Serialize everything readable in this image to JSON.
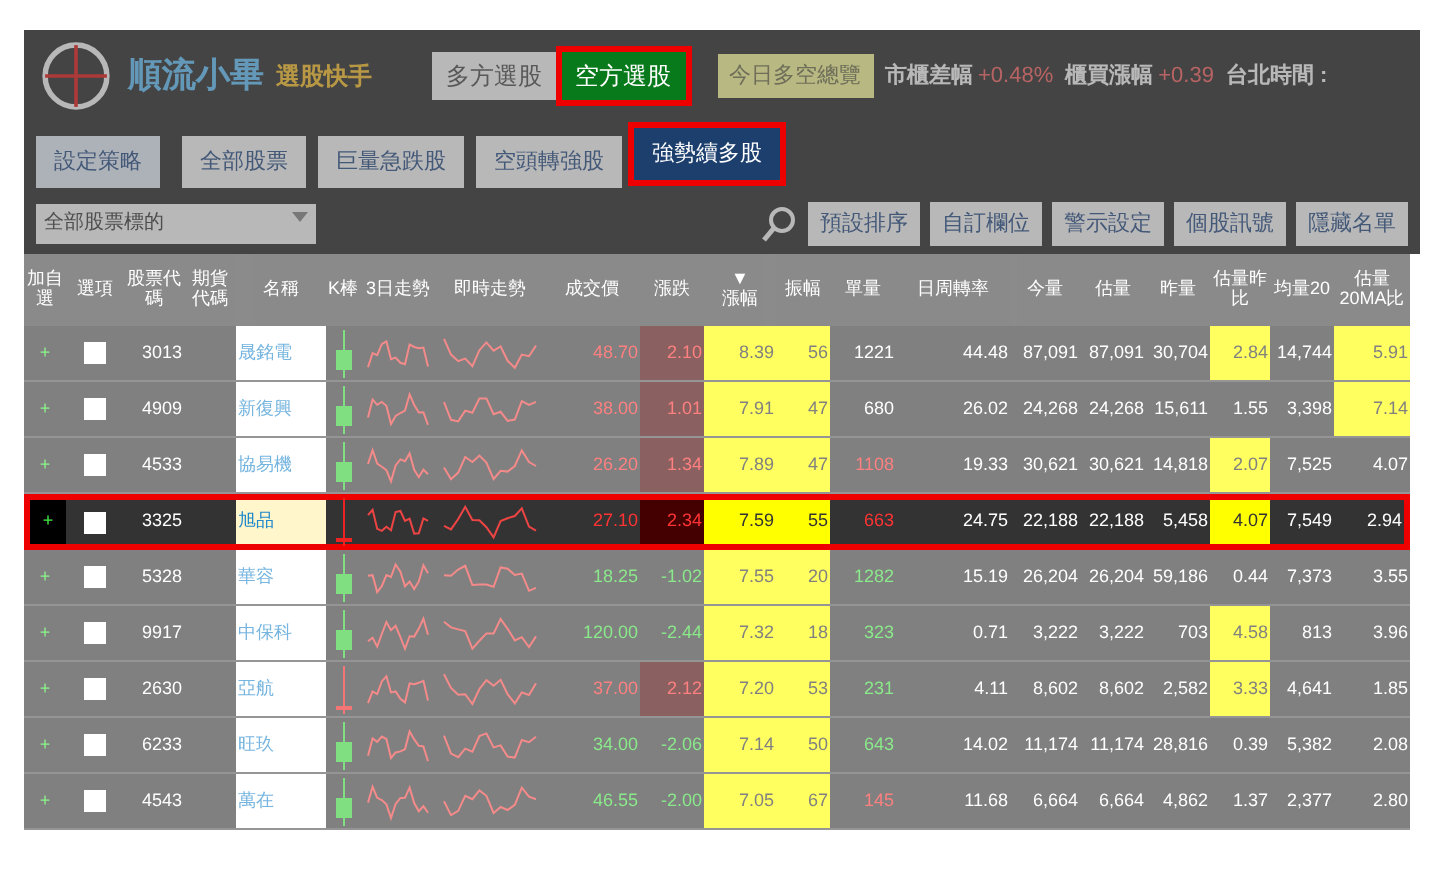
{
  "header": {
    "logo_title": "順流小畢",
    "logo_subtitle": "選股快手",
    "mode_buttons": [
      {
        "label": "多方選股",
        "selected": false
      },
      {
        "label": "空方選股",
        "selected": true
      }
    ],
    "overview_button": "今日多空總覽",
    "indices": [
      {
        "label": "市櫃差幅",
        "value": "+0.48%"
      },
      {
        "label": "櫃買漲幅",
        "value": "+0.39"
      }
    ],
    "clock_label": "台北時間 :"
  },
  "strategy_button": "設定策略",
  "strategy_tabs": [
    {
      "label": "全部股票",
      "selected": false
    },
    {
      "label": "巨量急跌股",
      "selected": false
    },
    {
      "label": "空頭轉強股",
      "selected": false
    },
    {
      "label": "強勢續多股",
      "selected": true
    }
  ],
  "filter_dropdown": "全部股票標的",
  "tool_buttons": [
    "預設排序",
    "自訂欄位",
    "警示設定",
    "個股訊號",
    "隱藏名單"
  ],
  "table": {
    "columns": [
      "加自選",
      "選項",
      "股票代碼",
      "期貨代碼",
      "名稱",
      "K棒",
      "3日走勢",
      "即時走勢",
      "成交價",
      "漲跌",
      "漲幅",
      "振幅",
      "單量",
      "日周轉率",
      "今量",
      "估量",
      "昨量",
      "估量昨比",
      "均量20",
      "估量20MA比"
    ],
    "sorted_column": "▼",
    "rows": [
      {
        "selected": false,
        "add": "+",
        "code": "3013",
        "name": "晟銘電",
        "candle_up": true,
        "price_up": true,
        "price": "48.70",
        "change": "2.10",
        "pct": "8.39",
        "amp": "56",
        "vol": "1221",
        "vol_up": false,
        "vol_down": false,
        "checked": false,
        "turnover": "44.48",
        "today": "87,091",
        "est": "87,091",
        "yest": "30,704",
        "ratio": "2.84",
        "ratio_hl": true,
        "avg20": "14,744",
        "ma": "5.91",
        "ma_hl": true
      },
      {
        "selected": false,
        "add": "+",
        "code": "4909",
        "name": "新復興",
        "candle_up": true,
        "price_up": true,
        "price": "38.00",
        "change": "1.01",
        "pct": "7.91",
        "amp": "47",
        "vol": "680",
        "vol_up": false,
        "vol_down": false,
        "checked": false,
        "turnover": "26.02",
        "today": "24,268",
        "est": "24,268",
        "yest": "15,611",
        "ratio": "1.55",
        "ratio_hl": false,
        "avg20": "3,398",
        "ma": "7.14",
        "ma_hl": true
      },
      {
        "selected": false,
        "add": "+",
        "code": "4533",
        "name": "協易機",
        "candle_up": true,
        "price_up": true,
        "price": "26.20",
        "change": "1.34",
        "pct": "7.89",
        "amp": "47",
        "vol": "1108",
        "vol_up": true,
        "vol_down": false,
        "checked": false,
        "turnover": "19.33",
        "today": "30,621",
        "est": "30,621",
        "yest": "14,818",
        "ratio": "2.07",
        "ratio_hl": true,
        "avg20": "7,525",
        "ma": "4.07",
        "ma_hl": false
      },
      {
        "selected": true,
        "add": "+",
        "code": "3325",
        "name": "旭品",
        "candle_up": false,
        "price_up": true,
        "price": "27.10",
        "change": "2.34",
        "pct": "7.59",
        "amp": "55",
        "vol": "663",
        "vol_up": true,
        "vol_down": false,
        "checked": false,
        "turnover": "24.75",
        "today": "22,188",
        "est": "22,188",
        "yest": "5,458",
        "ratio": "4.07",
        "ratio_hl": true,
        "avg20": "7,549",
        "ma": "2.94",
        "ma_hl": false
      },
      {
        "selected": false,
        "add": "+",
        "code": "5328",
        "name": "華容",
        "candle_up": true,
        "price_up": false,
        "price": "18.25",
        "change": "-1.02",
        "pct": "7.55",
        "amp": "20",
        "vol": "1282",
        "vol_up": false,
        "vol_down": true,
        "checked": false,
        "turnover": "15.19",
        "today": "26,204",
        "est": "26,204",
        "yest": "59,186",
        "ratio": "0.44",
        "ratio_hl": false,
        "avg20": "7,373",
        "ma": "3.55",
        "ma_hl": false
      },
      {
        "selected": false,
        "add": "+",
        "code": "9917",
        "name": "中保科",
        "candle_up": true,
        "price_up": false,
        "price": "120.00",
        "change": "-2.44",
        "pct": "7.32",
        "amp": "18",
        "vol": "323",
        "vol_up": false,
        "vol_down": true,
        "checked": false,
        "turnover": "0.71",
        "today": "3,222",
        "est": "3,222",
        "yest": "703",
        "ratio": "4.58",
        "ratio_hl": true,
        "avg20": "813",
        "ma": "3.96",
        "ma_hl": false
      },
      {
        "selected": false,
        "add": "+",
        "code": "2630",
        "name": "亞航",
        "candle_up": false,
        "price_up": true,
        "price": "37.00",
        "change": "2.12",
        "pct": "7.20",
        "amp": "53",
        "vol": "231",
        "vol_up": false,
        "vol_down": true,
        "checked": false,
        "turnover": "4.11",
        "today": "8,602",
        "est": "8,602",
        "yest": "2,582",
        "ratio": "3.33",
        "ratio_hl": true,
        "avg20": "4,641",
        "ma": "1.85",
        "ma_hl": false
      },
      {
        "selected": false,
        "add": "+",
        "code": "6233",
        "name": "旺玖",
        "candle_up": true,
        "price_up": false,
        "price": "34.00",
        "change": "-2.06",
        "pct": "7.14",
        "amp": "50",
        "vol": "643",
        "vol_up": false,
        "vol_down": true,
        "checked": false,
        "turnover": "14.02",
        "today": "11,174",
        "est": "11,174",
        "yest": "28,816",
        "ratio": "0.39",
        "ratio_hl": false,
        "avg20": "5,382",
        "ma": "2.08",
        "ma_hl": false
      },
      {
        "selected": false,
        "add": "+",
        "code": "4543",
        "name": "萬在",
        "candle_up": true,
        "price_up": false,
        "price": "46.55",
        "change": "-2.00",
        "pct": "7.05",
        "amp": "67",
        "vol": "145",
        "vol_up": true,
        "vol_down": false,
        "checked": false,
        "turnover": "11.68",
        "today": "6,664",
        "est": "6,664",
        "yest": "4,862",
        "ratio": "1.37",
        "ratio_hl": false,
        "avg20": "2,377",
        "ma": "2.80",
        "ma_hl": false
      }
    ]
  }
}
